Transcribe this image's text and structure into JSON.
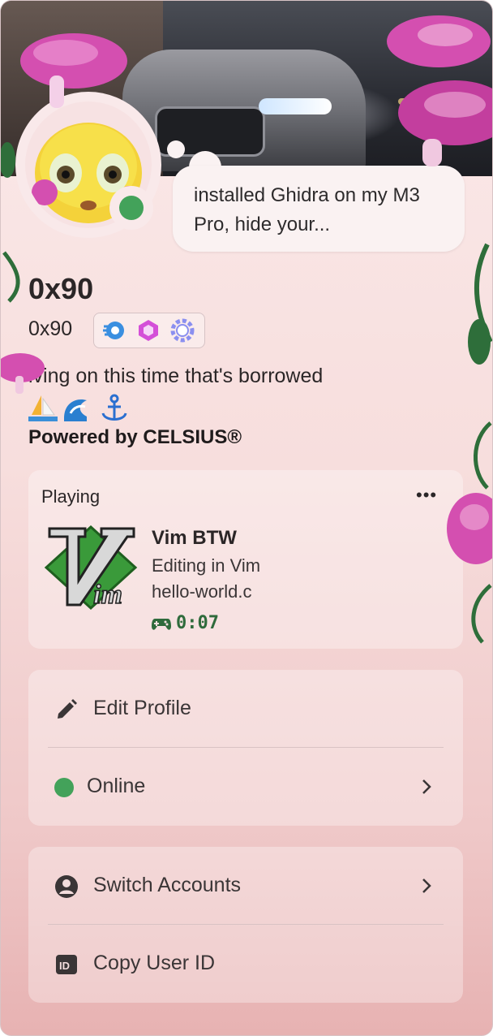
{
  "banner": {
    "image": "car-at-night-banner"
  },
  "avatar": {
    "image": "cursed-emoji-avatar",
    "status_color": "#43a25a"
  },
  "custom_status": "installed Ghidra on my M3 Pro, hide your...",
  "profile": {
    "display_name": "0x90",
    "username": "0x90",
    "badges": [
      "nitro-boost-icon",
      "hypesquad-icon",
      "quest-badge-icon"
    ],
    "bio": "iving on this time that's borrowed",
    "bio_emojis": "⛵🌊⚓",
    "powered_by": "Powered by CELSIUS®"
  },
  "activity": {
    "header": "Playing",
    "more_icon": "•••",
    "game_name": "Vim BTW",
    "details": "Editing in Vim",
    "state": "hello-world.c",
    "elapsed": "0:07",
    "icon": "vim-logo"
  },
  "menu": {
    "edit_profile": "Edit Profile",
    "online": "Online",
    "switch_accounts": "Switch Accounts",
    "copy_user_id": "Copy User ID"
  },
  "colors": {
    "online": "#43a25a",
    "elapsed_text": "#2f6b3c",
    "card_top": "#fbeaea",
    "card_bottom": "#e7b2b2"
  }
}
